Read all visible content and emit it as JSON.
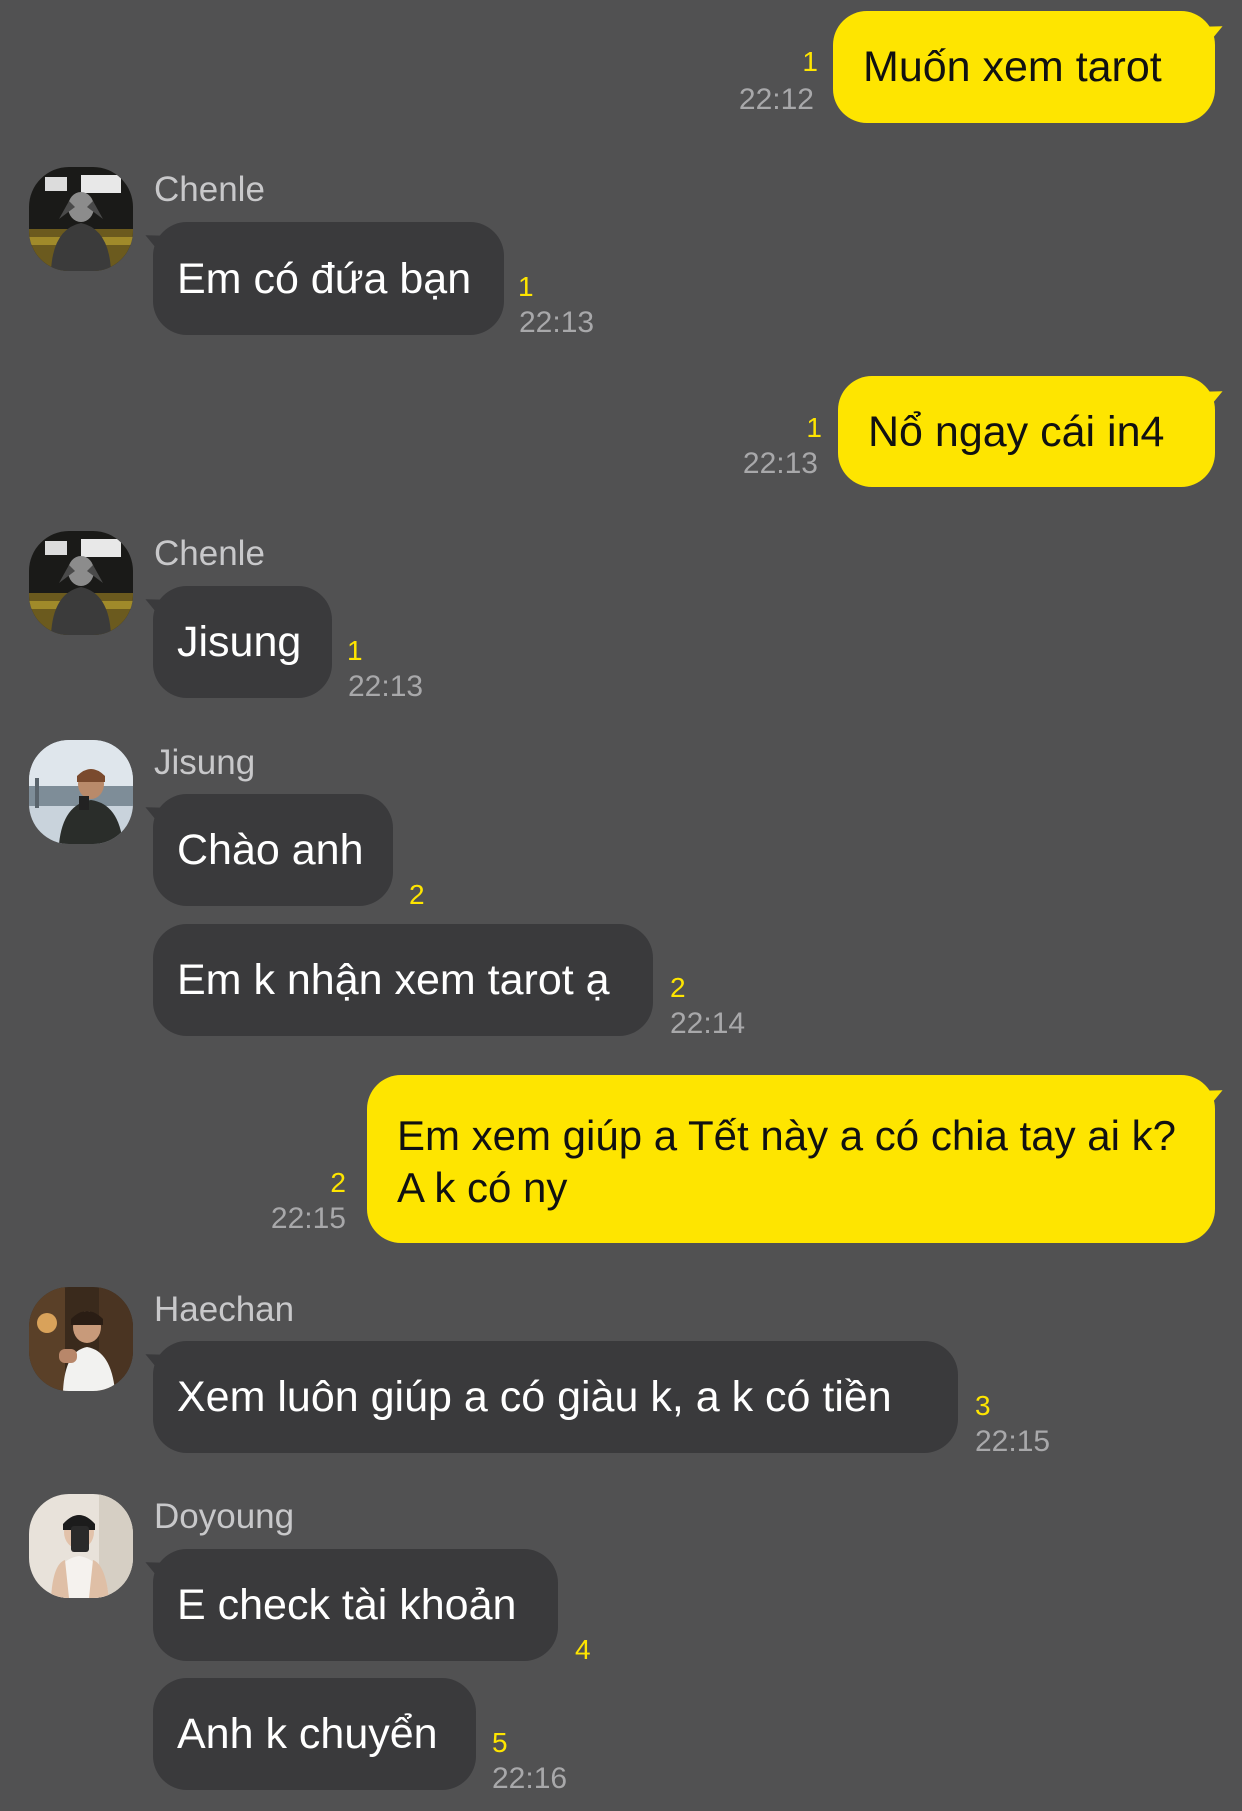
{
  "colors": {
    "background": "#515152",
    "outgoing_bubble": "#FEE500",
    "incoming_bubble": "#3A3A3C",
    "unread_count": "#FEE500",
    "timestamp": "#A8A8AA",
    "sender_name": "#C8C8CA"
  },
  "messages": [
    {
      "direction": "out",
      "text": "Muốn xem tarot",
      "unread": "1",
      "time": "22:12"
    },
    {
      "direction": "in",
      "sender": "Chenle",
      "avatar": "avatar-chenle-icon",
      "text": "Em có đứa bạn",
      "unread": "1",
      "time": "22:13"
    },
    {
      "direction": "out",
      "text": "Nổ ngay cái in4",
      "unread": "1",
      "time": "22:13"
    },
    {
      "direction": "in",
      "sender": "Chenle",
      "avatar": "avatar-chenle-icon",
      "text": "Jisung",
      "unread": "1",
      "time": "22:13"
    },
    {
      "direction": "in",
      "sender": "Jisung",
      "avatar": "avatar-jisung-icon",
      "text": "Chào anh",
      "unread": "2",
      "time": ""
    },
    {
      "direction": "in",
      "text": "Em k nhận xem tarot ạ",
      "unread": "2",
      "time": "22:14"
    },
    {
      "direction": "out",
      "text": "Em xem giúp a Tết này a có chia tay ai k? A k có ny",
      "unread": "2",
      "time": "22:15"
    },
    {
      "direction": "in",
      "sender": "Haechan",
      "avatar": "avatar-haechan-icon",
      "text": "Xem luôn giúp a có giàu k, a k có tiền",
      "unread": "3",
      "time": "22:15"
    },
    {
      "direction": "in",
      "sender": "Doyoung",
      "avatar": "avatar-doyoung-icon",
      "text": "E check tài khoản",
      "unread": "4",
      "time": ""
    },
    {
      "direction": "in",
      "text": "Anh k chuyển",
      "unread": "5",
      "time": "22:16"
    }
  ]
}
